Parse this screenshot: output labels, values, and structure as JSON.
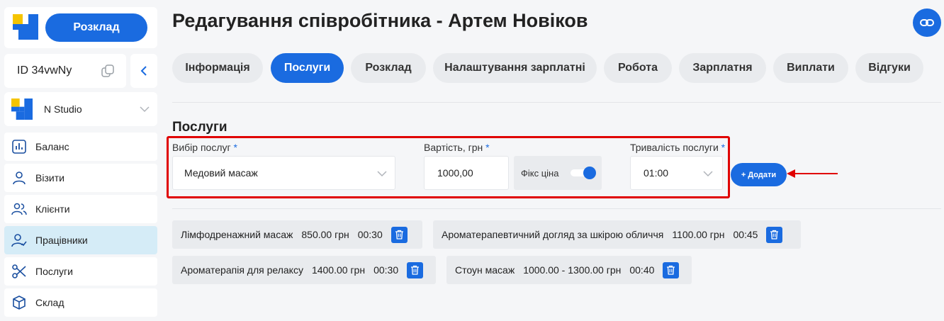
{
  "sidebar": {
    "schedule_button": "Розклад",
    "id_label": "ID 34vwNy",
    "studio_name": "N Studio",
    "items": [
      {
        "label": "Баланс",
        "icon": "chart-icon"
      },
      {
        "label": "Візити",
        "icon": "user-icon"
      },
      {
        "label": "Клієнти",
        "icon": "users-icon"
      },
      {
        "label": "Працівники",
        "icon": "user-check-icon"
      },
      {
        "label": "Послуги",
        "icon": "scissors-icon"
      },
      {
        "label": "Склад",
        "icon": "box-icon"
      }
    ],
    "active_index": 3
  },
  "page": {
    "title": "Редагування співробітника - Артем Новіков"
  },
  "tabs": [
    {
      "label": "Інформація"
    },
    {
      "label": "Послуги"
    },
    {
      "label": "Розклад"
    },
    {
      "label": "Налаштування зарплатні"
    },
    {
      "label": "Робота"
    },
    {
      "label": "Зарплатня"
    },
    {
      "label": "Виплати"
    },
    {
      "label": "Відгуки"
    }
  ],
  "active_tab": 1,
  "services_form": {
    "section_title": "Послуги",
    "service_label": "Вибір послуг",
    "service_value": "Медовий масаж",
    "price_label": "Вартість, грн",
    "price_value": "1000,00",
    "fixed_price_label": "Фікс ціна",
    "fixed_price_on": true,
    "duration_label": "Тривалість послуги",
    "duration_value": "01:00",
    "required_mark": "*",
    "add_button": "+ Додати"
  },
  "assigned_services": [
    {
      "name": "Лімфодренажний масаж",
      "price": "850.00 грн",
      "duration": "00:30"
    },
    {
      "name": "Ароматерапевтичний догляд за шкірою обличчя",
      "price": "1100.00 грн",
      "duration": "00:45"
    },
    {
      "name": "Ароматерапія для релаксу",
      "price": "1400.00 грн",
      "duration": "00:30"
    },
    {
      "name": "Стоун масаж",
      "price": "1000.00 - 1300.00 грн",
      "duration": "00:40"
    }
  ],
  "colors": {
    "primary": "#1a6be0",
    "active_nav": "#d5ecf7",
    "highlight": "#e00000"
  }
}
